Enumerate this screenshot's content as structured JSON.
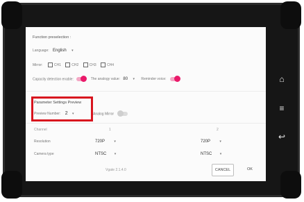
{
  "section1": {
    "title": "Function preselection :",
    "language_label": "Language:",
    "language_value": "English",
    "mirror_label": "Mirror:",
    "channels": [
      "CH1",
      "CH2",
      "CH3",
      "CH4"
    ],
    "capacity_label": "Capacity detection enable:",
    "low_voltage_label": "The analogy value:",
    "low_voltage_value": "80",
    "reminder_label": "Reminder voice:"
  },
  "section2": {
    "title": "Parameter Settings Preview",
    "preview_label": "Preview Number:",
    "preview_value": "2",
    "mirror_label": "Analog Mirror",
    "channel_label": "Channel",
    "col1": "1",
    "col2": "2",
    "resolution_label": "Resolution",
    "res1": "720P",
    "res2": "720P",
    "camera_type_label": "Camera type",
    "type1": "NTSC",
    "type2": "NTSC"
  },
  "footer": {
    "version": "Vgate 2.1.4.0",
    "cancel_label": "CANCEL",
    "ok_label": "OK"
  },
  "side_buttons": {
    "home": "⌂",
    "menu": "≡",
    "back": "↩"
  },
  "colors": {
    "accent": "#ea1a6a",
    "highlight": "#d8141e"
  }
}
